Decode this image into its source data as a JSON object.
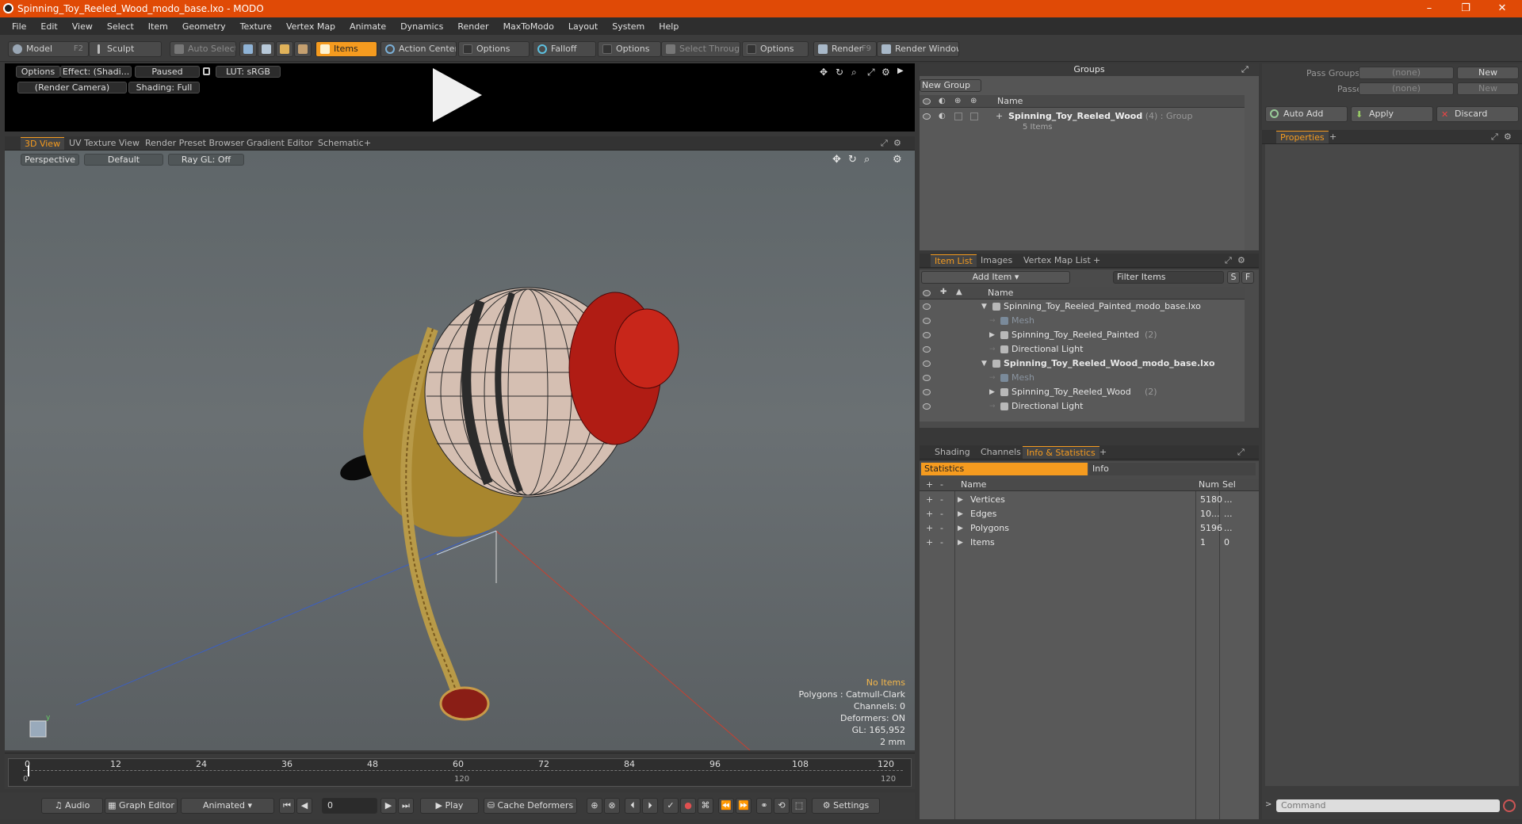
{
  "window": {
    "title": "Spinning_Toy_Reeled_Wood_modo_base.lxo - MODO",
    "minimize": "–",
    "maximize": "❐",
    "close": "✕"
  },
  "menu": [
    "File",
    "Edit",
    "View",
    "Select",
    "Item",
    "Geometry",
    "Texture",
    "Vertex Map",
    "Animate",
    "Dynamics",
    "Render",
    "MaxToModo",
    "Layout",
    "System",
    "Help"
  ],
  "toolbar": {
    "model": "Model",
    "model_key": "F2",
    "sculpt": "Sculpt",
    "auto_select": "Auto Select",
    "items": "Items",
    "action_center": "Action Center",
    "options1": "Options",
    "falloff": "Falloff",
    "options2": "Options",
    "select_through": "Select Through",
    "options3": "Options",
    "render": "Render",
    "render_key": "F9",
    "render_window": "Render Window"
  },
  "preview": {
    "options": "Options",
    "effect": "Effect: (Shadi...",
    "paused": "Paused",
    "lut": "LUT: sRGB",
    "camera": "(Render Camera)",
    "shading": "Shading: Full"
  },
  "view_tabs": [
    "3D View",
    "UV Texture View",
    "Render Preset Browser",
    "Gradient Editor",
    "Schematic"
  ],
  "viewport": {
    "perspective": "Perspective",
    "default": "Default",
    "raygl": "Ray GL: Off",
    "hud": {
      "items": "No Items",
      "polygons": "Polygons : Catmull-Clark",
      "channels": "Channels: 0",
      "deformers": "Deformers: ON",
      "gl": "GL: 165,952",
      "scale": "2 mm"
    }
  },
  "timeline": {
    "ticks": [
      "0",
      "12",
      "24",
      "36",
      "48",
      "60",
      "72",
      "84",
      "96",
      "108",
      "120"
    ],
    "start": "0",
    "mid": "120",
    "end": "120"
  },
  "transport": {
    "audio": "Audio",
    "graph_editor": "Graph Editor",
    "animated": "Animated",
    "frame": "0",
    "play": "Play",
    "cache": "Cache Deformers",
    "settings": "Settings"
  },
  "groups": {
    "title": "Groups",
    "new_group": "New Group",
    "col_name": "Name",
    "group_name": "Spinning_Toy_Reeled_Wood",
    "group_count": "(4)",
    "group_type": ": Group",
    "group_items": "5 Items"
  },
  "item_tabs": [
    "Item List",
    "Images",
    "Vertex Map List"
  ],
  "item_list": {
    "add_item": "Add Item",
    "filter": "Filter Items",
    "s": "S",
    "f": "F",
    "col_name": "Name",
    "rows": [
      {
        "label": "Spinning_Toy_Reeled_Painted_modo_base.lxo",
        "extra": "",
        "bold": false,
        "dim": false,
        "indent": 0,
        "arrow": "▼"
      },
      {
        "label": "Mesh",
        "extra": "",
        "bold": false,
        "dim": true,
        "indent": 1,
        "arrow": ""
      },
      {
        "label": "Spinning_Toy_Reeled_Painted",
        "extra": "(2)",
        "bold": false,
        "dim": false,
        "indent": 1,
        "arrow": "▶"
      },
      {
        "label": "Directional Light",
        "extra": "",
        "bold": false,
        "dim": false,
        "indent": 1,
        "arrow": ""
      },
      {
        "label": "Spinning_Toy_Reeled_Wood_modo_base.lxo",
        "extra": "",
        "bold": true,
        "dim": false,
        "indent": 0,
        "arrow": "▼"
      },
      {
        "label": "Mesh",
        "extra": "",
        "bold": false,
        "dim": true,
        "indent": 1,
        "arrow": ""
      },
      {
        "label": "Spinning_Toy_Reeled_Wood",
        "extra": "(2)",
        "bold": false,
        "dim": false,
        "indent": 1,
        "arrow": "▶"
      },
      {
        "label": "Directional Light",
        "extra": "",
        "bold": false,
        "dim": false,
        "indent": 1,
        "arrow": ""
      }
    ]
  },
  "stats_tabs": [
    "Shading",
    "Channels",
    "Info & Statistics"
  ],
  "stats": {
    "statistics": "Statistics",
    "info": "Info",
    "col_name": "Name",
    "col_num": "Num",
    "col_sel": "Sel",
    "rows": [
      {
        "name": "Vertices",
        "num": "5180",
        "sel": "..."
      },
      {
        "name": "Edges",
        "num": "10...",
        "sel": "..."
      },
      {
        "name": "Polygons",
        "num": "5196",
        "sel": "..."
      },
      {
        "name": "Items",
        "num": "1",
        "sel": "0"
      }
    ]
  },
  "right": {
    "pass_groups": "Pass Groups",
    "passes": "Passes",
    "none": "(none)",
    "new": "New",
    "auto_add": "Auto Add",
    "apply": "Apply",
    "discard": "Discard",
    "properties": "Properties",
    "command": "Command"
  }
}
